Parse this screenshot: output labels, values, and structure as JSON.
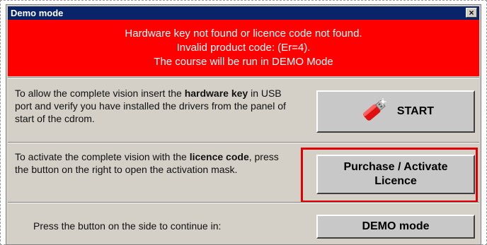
{
  "window": {
    "title": "Demo mode",
    "close_label": "×"
  },
  "alert": {
    "line1": "Hardware key not found or licence code not found.",
    "line2": "Invalid product code: (Er=4).",
    "line3": "The course will be run in DEMO Mode",
    "background": "#ff0000"
  },
  "hardware_section": {
    "text_a": "To allow the complete vision insert the ",
    "text_bold": "hardware key",
    "text_b": " in USB port and verify you have installed the drivers from the panel of start of the cdrom.",
    "button_label": "START",
    "icon": "usb-stick-icon"
  },
  "licence_section": {
    "text_a": "To activate the complete vision with the ",
    "text_bold": "licence code",
    "text_b": ", press the button on the right to open the activation mask.",
    "button_line1": "Purchase / Activate",
    "button_line2": "Licence"
  },
  "demo_section": {
    "text": "Press the button on the side to continue in:",
    "button_label": "DEMO mode"
  }
}
